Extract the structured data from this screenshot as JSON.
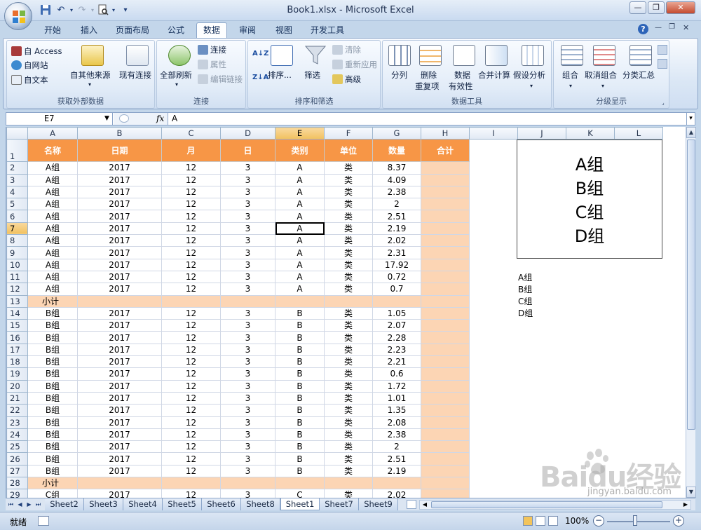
{
  "window": {
    "title": "Book1.xlsx - Microsoft Excel",
    "minimize": "—",
    "restore": "❐",
    "close": "✕"
  },
  "qat": {
    "save_icon": "save-icon",
    "undo_icon": "undo-icon",
    "redo_icon": "redo-icon",
    "preview_icon": "print-preview-icon",
    "customize": "▾"
  },
  "tabs": [
    "开始",
    "插入",
    "页面布局",
    "公式",
    "数据",
    "审阅",
    "视图",
    "开发工具"
  ],
  "active_tab": "数据",
  "help": "?",
  "ribbon": {
    "external": {
      "access": "自 Access",
      "web": "自网站",
      "text": "自文本",
      "other": "自其他来源",
      "existing": "现有连接",
      "label": "获取外部数据"
    },
    "connections": {
      "refresh": "全部刷新",
      "conn": "连接",
      "props": "属性",
      "edit_links": "编辑链接",
      "label": "连接"
    },
    "sortfilter": {
      "az": "A↓Z",
      "za": "Z↓A",
      "sort": "排序...",
      "filter": "筛选",
      "clear": "清除",
      "reapply": "重新应用",
      "advanced": "高级",
      "label": "排序和筛选"
    },
    "datatools": {
      "split": "分列",
      "remove_dup_1": "删除",
      "remove_dup_2": "重复项",
      "validation_1": "数据",
      "validation_2": "有效性",
      "consolidate": "合并计算",
      "whatif": "假设分析",
      "label": "数据工具"
    },
    "outline": {
      "group": "组合",
      "ungroup": "取消组合",
      "subtotal": "分类汇总",
      "label": "分级显示"
    }
  },
  "formula_bar": {
    "name_box": "E7",
    "fx": "fx",
    "value": "A"
  },
  "columns": [
    "A",
    "B",
    "C",
    "D",
    "E",
    "F",
    "G",
    "H",
    "I",
    "J",
    "K",
    "L"
  ],
  "header_row": [
    "名称",
    "日期",
    "月",
    "日",
    "类别",
    "单位",
    "数量",
    "合计"
  ],
  "rows": [
    {
      "n": "2",
      "cells": [
        "A组",
        "2017",
        "12",
        "3",
        "A",
        "类",
        "8.37"
      ]
    },
    {
      "n": "3",
      "cells": [
        "A组",
        "2017",
        "12",
        "3",
        "A",
        "类",
        "4.09"
      ]
    },
    {
      "n": "4",
      "cells": [
        "A组",
        "2017",
        "12",
        "3",
        "A",
        "类",
        "2.38"
      ]
    },
    {
      "n": "5",
      "cells": [
        "A组",
        "2017",
        "12",
        "3",
        "A",
        "类",
        "2"
      ]
    },
    {
      "n": "6",
      "cells": [
        "A组",
        "2017",
        "12",
        "3",
        "A",
        "类",
        "2.51"
      ]
    },
    {
      "n": "7",
      "cells": [
        "A组",
        "2017",
        "12",
        "3",
        "A",
        "类",
        "2.19"
      ]
    },
    {
      "n": "8",
      "cells": [
        "A组",
        "2017",
        "12",
        "3",
        "A",
        "类",
        "2.02"
      ]
    },
    {
      "n": "9",
      "cells": [
        "A组",
        "2017",
        "12",
        "3",
        "A",
        "类",
        "2.31"
      ]
    },
    {
      "n": "10",
      "cells": [
        "A组",
        "2017",
        "12",
        "3",
        "A",
        "类",
        "17.92"
      ]
    },
    {
      "n": "11",
      "cells": [
        "A组",
        "2017",
        "12",
        "3",
        "A",
        "类",
        "0.72"
      ]
    },
    {
      "n": "12",
      "cells": [
        "A组",
        "2017",
        "12",
        "3",
        "A",
        "类",
        "0.7"
      ]
    },
    {
      "n": "13",
      "subtotal": "小计"
    },
    {
      "n": "14",
      "cells": [
        "B组",
        "2017",
        "12",
        "3",
        "B",
        "类",
        "1.05"
      ]
    },
    {
      "n": "15",
      "cells": [
        "B组",
        "2017",
        "12",
        "3",
        "B",
        "类",
        "2.07"
      ]
    },
    {
      "n": "16",
      "cells": [
        "B组",
        "2017",
        "12",
        "3",
        "B",
        "类",
        "2.28"
      ]
    },
    {
      "n": "17",
      "cells": [
        "B组",
        "2017",
        "12",
        "3",
        "B",
        "类",
        "2.23"
      ]
    },
    {
      "n": "18",
      "cells": [
        "B组",
        "2017",
        "12",
        "3",
        "B",
        "类",
        "2.21"
      ]
    },
    {
      "n": "19",
      "cells": [
        "B组",
        "2017",
        "12",
        "3",
        "B",
        "类",
        "0.6"
      ]
    },
    {
      "n": "20",
      "cells": [
        "B组",
        "2017",
        "12",
        "3",
        "B",
        "类",
        "1.72"
      ]
    },
    {
      "n": "21",
      "cells": [
        "B组",
        "2017",
        "12",
        "3",
        "B",
        "类",
        "1.01"
      ]
    },
    {
      "n": "22",
      "cells": [
        "B组",
        "2017",
        "12",
        "3",
        "B",
        "类",
        "1.35"
      ]
    },
    {
      "n": "23",
      "cells": [
        "B组",
        "2017",
        "12",
        "3",
        "B",
        "类",
        "2.08"
      ]
    },
    {
      "n": "24",
      "cells": [
        "B组",
        "2017",
        "12",
        "3",
        "B",
        "类",
        "2.38"
      ]
    },
    {
      "n": "25",
      "cells": [
        "B组",
        "2017",
        "12",
        "3",
        "B",
        "类",
        "2"
      ]
    },
    {
      "n": "26",
      "cells": [
        "B组",
        "2017",
        "12",
        "3",
        "B",
        "类",
        "2.51"
      ]
    },
    {
      "n": "27",
      "cells": [
        "B组",
        "2017",
        "12",
        "3",
        "B",
        "类",
        "2.19"
      ]
    },
    {
      "n": "28",
      "subtotal": "小计"
    },
    {
      "n": "29",
      "cells": [
        "C组",
        "2017",
        "12",
        "3",
        "C",
        "类",
        "2.02"
      ]
    }
  ],
  "box_items": [
    "A组",
    "B组",
    "C组",
    "D组"
  ],
  "list_items": [
    "A组",
    "B组",
    "C组",
    "D组"
  ],
  "sheet_tabs": [
    "Sheet2",
    "Sheet3",
    "Sheet4",
    "Sheet5",
    "Sheet6",
    "Sheet8",
    "Sheet1",
    "Sheet7",
    "Sheet9"
  ],
  "active_sheet": "Sheet1",
  "status": {
    "ready": "就绪",
    "zoom": "100%",
    "zoom_out": "−",
    "zoom_in": "+"
  },
  "watermark": {
    "text": "Baidu经验",
    "url": "jingyan.baidu.com"
  },
  "colors": {
    "header_orange": "#f79646",
    "total_peach": "#fcd5b4",
    "ribbon_blue": "#c3d6ea"
  }
}
